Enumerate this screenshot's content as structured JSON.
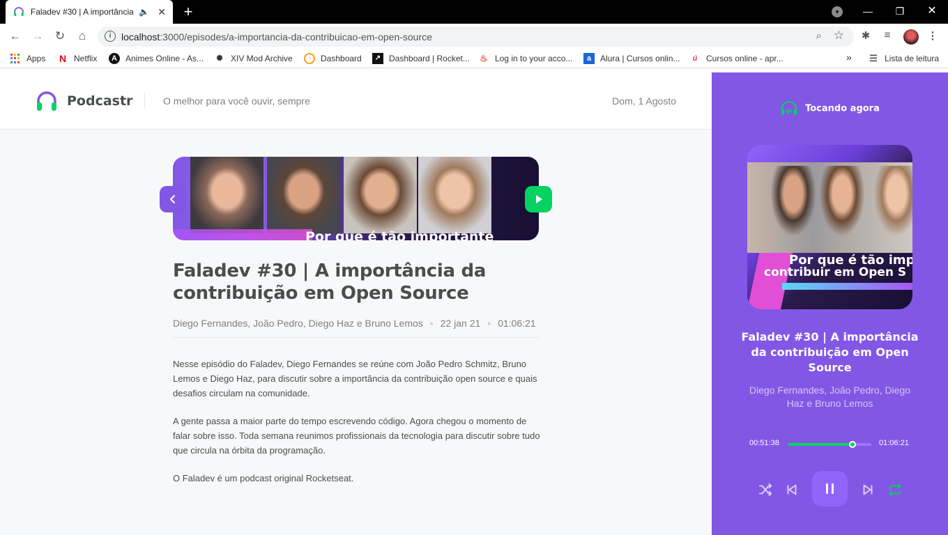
{
  "browser": {
    "tab": {
      "title": "Faladev #30 | A importância",
      "close": "✕"
    },
    "new_tab": "+",
    "url_host": "localhost",
    "url_rest": ":3000/episodes/a-importancia-da-contribuicao-em-open-source",
    "bookmarks": [
      {
        "label": "Apps"
      },
      {
        "label": "Netflix"
      },
      {
        "label": "Animes Online - As..."
      },
      {
        "label": "XIV Mod Archive"
      },
      {
        "label": "Dashboard"
      },
      {
        "label": "Dashboard | Rocket..."
      },
      {
        "label": "Log in to your acco..."
      },
      {
        "label": "Alura | Cursos onlin..."
      },
      {
        "label": "Cursos online - apr..."
      }
    ],
    "reading_list": "Lista de leitura",
    "overflow": "»"
  },
  "header": {
    "brand": "Podcastr",
    "tagline": "O melhor para você ouvir, sempre",
    "date": "Dom, 1 Agosto"
  },
  "episode": {
    "thumbnail_caption": "Por que é tão importante",
    "title": "Faladev #30 | A importância da contribuição em Open Source",
    "members": "Diego Fernandes, João Pedro, Diego Haz e Bruno Lemos",
    "published_at": "22 jan 21",
    "duration": "01:06:21",
    "description": [
      "Nesse episódio do Faladev, Diego Fernandes se reúne com João Pedro Schmitz, Bruno Lemos e Diego Haz, para discutir sobre a importância da contribuição open source e quais desafios circulam na comunidade.",
      "A gente passa a maior parte do tempo escrevendo código. Agora chegou o momento de falar sobre isso. Toda semana reunimos profissionais da tecnologia para discutir sobre tudo que circula na órbita da programação.",
      "O Faladev é um podcast original Rocketseat."
    ]
  },
  "player": {
    "heading": "Tocando agora",
    "cover_line1": "Por que é tão imp",
    "cover_line2": "contribuir em Open S",
    "title": "Faladev #30 | A importância da contribuição em Open Source",
    "members": "Diego Fernandes, João Pedro, Diego Haz e Bruno Lemos",
    "current_time": "00:51:38",
    "total_time": "01:06:21",
    "progress": 0.778,
    "is_playing": true
  },
  "colors": {
    "purple": "#8257e5",
    "purple_light": "#9164fa",
    "green": "#04d361",
    "text": "#494d4b",
    "muted": "#808080"
  },
  "icons": {
    "back": "chevron-left-icon",
    "play": "play-icon",
    "shuffle": "shuffle-icon",
    "previous": "skip-previous-icon",
    "pause": "pause-icon",
    "next": "skip-next-icon",
    "repeat": "repeat-icon"
  }
}
